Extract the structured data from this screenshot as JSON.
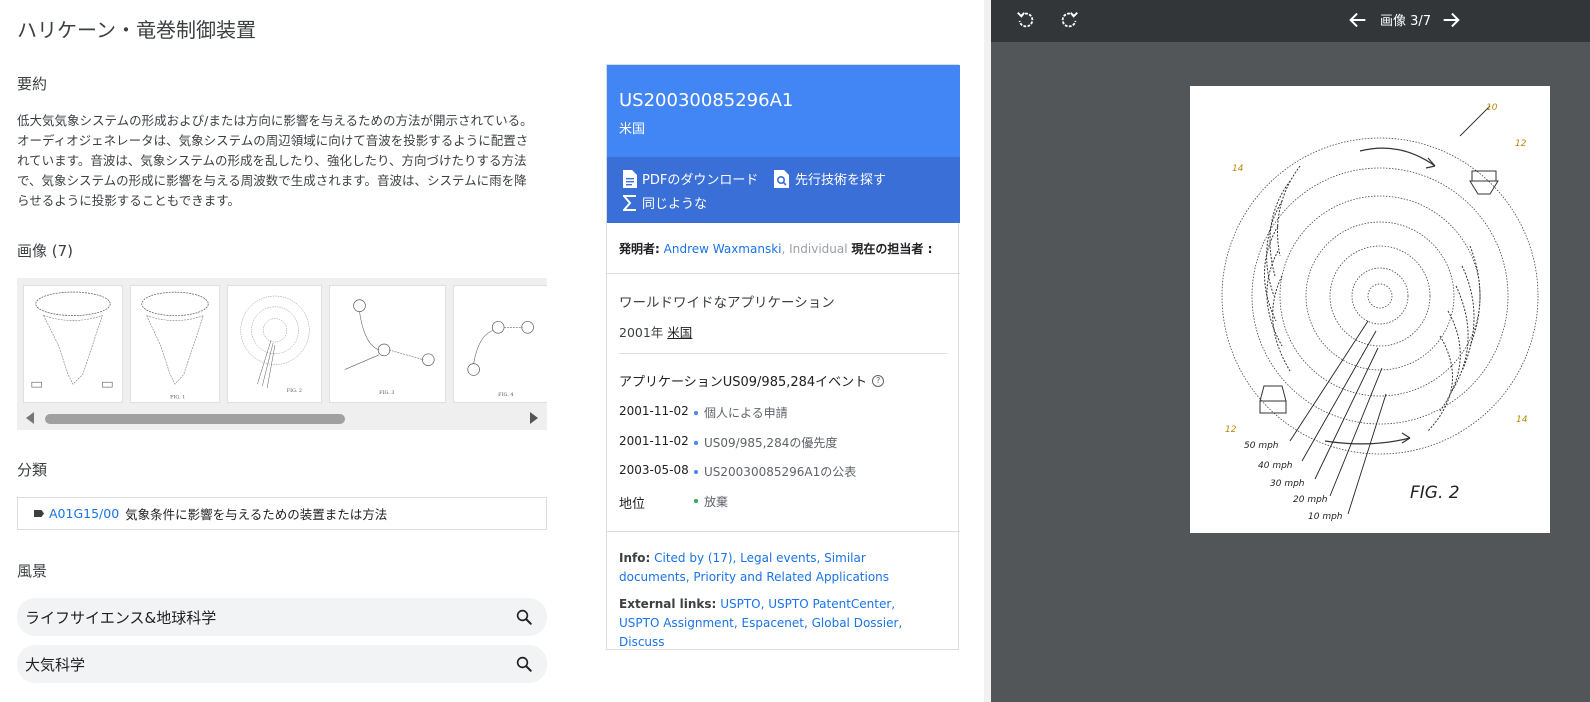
{
  "title": "ハリケーン・竜巻制御装置",
  "abstract": {
    "heading": "要約",
    "text": "低大気気象システムの形成および/または方向に影響を与えるための方法が開示されている。オーディオジェネレータは、気象システムの周辺領域に向けて音波を投影するように配置されています。音波は、気象システムの形成を乱したり、強化したり、方向づけたりする方法で、気象システムの形成に影響を与える周波数で生成されます。音波は、システムに雨を降らせるように投影することもできます。"
  },
  "images": {
    "heading": "画像 (7)",
    "thumbs": [
      "FIG. 1",
      "FIG. 2",
      "FIG. 3",
      "FIG. 4"
    ]
  },
  "classification": {
    "heading": "分類",
    "code": "A01G15/00",
    "description": "気象条件に影響を与えるための装置または方法"
  },
  "landscape": {
    "heading": "風景",
    "chips": [
      "ライフサイエンス&地球科学",
      "大気科学"
    ]
  },
  "card": {
    "pub_number": "US20030085296A1",
    "country": "米国",
    "actions": {
      "pdf": "PDFのダウンロード",
      "prior_art": "先行技術を探す",
      "similar": "同じような"
    },
    "inventor_label": "発明者:",
    "inventor_name": "Andrew Waxmanski",
    "inventor_type": ", Individual",
    "assignee_label": "現在の担当者 :",
    "worldwide_heading": "ワールドワイドなアプリケーション",
    "worldwide_year": "2001年",
    "worldwide_country": "米国",
    "application_heading": "アプリケーションUS09/985,284イベント",
    "help_icon": "?",
    "events": [
      {
        "date": "2001-11-02",
        "text": "個人による申請"
      },
      {
        "date": "2001-11-02",
        "text": "US09/985,284の優先度"
      },
      {
        "date": "2003-05-08",
        "text": "US20030085296A1の公表"
      },
      {
        "date": "地位",
        "text": "放棄"
      }
    ],
    "info_label": "Info:",
    "info_links": "Cited by (17), Legal events, Similar documents, Priority and Related Applications",
    "external_label": "External links:",
    "external_links": "USPTO, USPTO PatentCenter, USPTO Assignment, Espacenet, Global Dossier, Discuss"
  },
  "viewer": {
    "label": "画像 3/7",
    "figure_label": "FIG. 2",
    "ref_numbers": [
      "10",
      "12",
      "14",
      "12",
      "14"
    ],
    "speeds": [
      "50 mph",
      "40 mph",
      "30 mph",
      "20 mph",
      "10 mph"
    ]
  },
  "colors": {
    "accent": "#4285f4",
    "accent_dark": "#3b6fd8",
    "link": "#1a73e8",
    "viewer_bg": "#525659"
  }
}
